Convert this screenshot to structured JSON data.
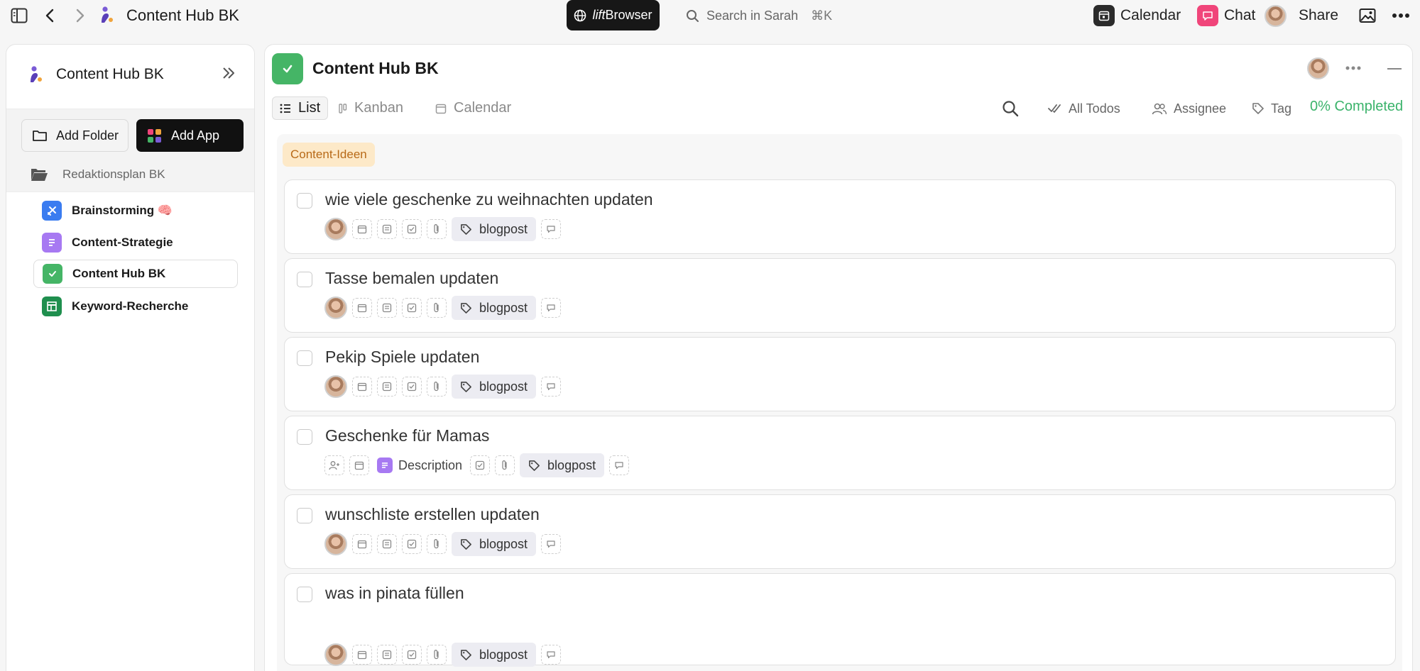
{
  "topbar": {
    "title": "Content Hub BK",
    "lift_brand": "lift",
    "lift_label": "Browser",
    "search_placeholder": "Search in Sarah",
    "search_shortcut": "⌘K",
    "calendar_label": "Calendar",
    "chat_label": "Chat",
    "share_label": "Share"
  },
  "sidebar": {
    "title": "Content Hub BK",
    "add_folder_label": "Add Folder",
    "add_app_label": "Add App",
    "folder_name": "Redaktionsplan BK",
    "items": [
      {
        "label": "Brainstorming 🧠",
        "color": "#3a7cf0",
        "active": false
      },
      {
        "label": "Content-Strategie",
        "color": "#a779f2",
        "active": false
      },
      {
        "label": "Content Hub BK",
        "color": "#45b566",
        "active": true
      },
      {
        "label": "Keyword-Recherche",
        "color": "#1f8f4e",
        "active": false
      }
    ]
  },
  "main": {
    "title": "Content Hub BK",
    "views": [
      "List",
      "Kanban",
      "Calendar"
    ],
    "selected_view": "List",
    "filters": {
      "all_todos": "All Todos",
      "assignee": "Assignee",
      "tag": "Tag"
    },
    "completed_label": "0% Completed",
    "group_label": "Content-Ideen",
    "tasks": [
      {
        "title": "wie viele geschenke zu weihnachten updaten",
        "tag": "blogpost",
        "has_description": false
      },
      {
        "title": "Tasse bemalen updaten",
        "tag": "blogpost",
        "has_description": false
      },
      {
        "title": "Pekip Spiele updaten",
        "tag": "blogpost",
        "has_description": false
      },
      {
        "title": "Geschenke für Mamas",
        "tag": "blogpost",
        "has_description": true,
        "description_label": "Description"
      },
      {
        "title": "wunschliste erstellen updaten",
        "tag": "blogpost",
        "has_description": false
      },
      {
        "title": "was in pinata füllen",
        "tag": "blogpost",
        "has_description": false
      }
    ]
  }
}
